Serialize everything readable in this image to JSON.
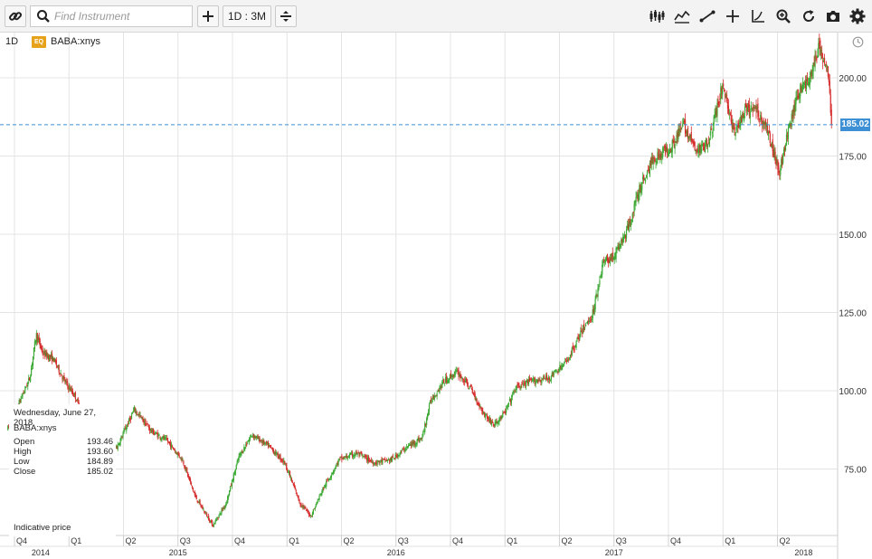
{
  "toolbar": {
    "link_icon": "link-icon",
    "search": {
      "placeholder": "Find Instrument",
      "value": ""
    },
    "add_icon": "plus-icon",
    "interval_label": "1D : 3M",
    "compare_icon": "compare-icon",
    "right_tools": [
      "candlestick-icon",
      "indicators-icon",
      "draw-line-icon",
      "crosshair-icon",
      "chart-type-icon",
      "zoom-icon",
      "refresh-icon",
      "camera-icon",
      "gear-icon"
    ]
  },
  "header": {
    "interval": "1D",
    "badge": "EQ",
    "symbol": "BABA:xnys"
  },
  "last_price": "185.02",
  "colors": {
    "up": "#3aa832",
    "down": "#d62b2b",
    "last_line": "#3d8fd6",
    "grid": "#e4e4e4"
  },
  "info_panel": {
    "date": "Wednesday, June 27, 2018",
    "symbol": "BABA:xnys",
    "rows": [
      {
        "label": "Open",
        "value": "193.46"
      },
      {
        "label": "High",
        "value": "193.60"
      },
      {
        "label": "Low",
        "value": "184.89"
      },
      {
        "label": "Close",
        "value": "185.02"
      }
    ],
    "note": "Indicative price"
  },
  "chart_data": {
    "type": "candlestick",
    "ylim": [
      53,
      215
    ],
    "y_ticks": [
      "200.00",
      "175.00",
      "150.00",
      "125.00",
      "100.00",
      "75.00"
    ],
    "y_tick_values": [
      200,
      175,
      150,
      125,
      100,
      75
    ],
    "x_range": [
      2014.8,
      2018.52
    ],
    "quarter_ticks": [
      {
        "label": "Q4",
        "x": 2014.75
      },
      {
        "label": "Q1",
        "x": 2015.0
      },
      {
        "label": "Q2",
        "x": 2015.25
      },
      {
        "label": "Q3",
        "x": 2015.5
      },
      {
        "label": "Q4",
        "x": 2015.75
      },
      {
        "label": "Q1",
        "x": 2016.0
      },
      {
        "label": "Q2",
        "x": 2016.25
      },
      {
        "label": "Q3",
        "x": 2016.5
      },
      {
        "label": "Q4",
        "x": 2016.75
      },
      {
        "label": "Q1",
        "x": 2017.0
      },
      {
        "label": "Q2",
        "x": 2017.25
      },
      {
        "label": "Q3",
        "x": 2017.5
      },
      {
        "label": "Q4",
        "x": 2017.75
      },
      {
        "label": "Q1",
        "x": 2018.0
      },
      {
        "label": "Q2",
        "x": 2018.25
      }
    ],
    "year_ticks": [
      {
        "label": "2014",
        "x": 2014.87
      },
      {
        "label": "2015",
        "x": 2015.5
      },
      {
        "label": "2016",
        "x": 2016.5
      },
      {
        "label": "2017",
        "x": 2017.5
      },
      {
        "label": "2018",
        "x": 2018.37
      }
    ],
    "price_path": [
      [
        2014.72,
        88
      ],
      [
        2014.82,
        104
      ],
      [
        2014.85,
        118
      ],
      [
        2014.88,
        112
      ],
      [
        2014.93,
        110
      ],
      [
        2014.98,
        103
      ],
      [
        2015.03,
        98
      ],
      [
        2015.08,
        88
      ],
      [
        2015.15,
        84
      ],
      [
        2015.22,
        82
      ],
      [
        2015.3,
        94
      ],
      [
        2015.38,
        87
      ],
      [
        2015.45,
        84
      ],
      [
        2015.52,
        78
      ],
      [
        2015.58,
        66
      ],
      [
        2015.66,
        57
      ],
      [
        2015.72,
        64
      ],
      [
        2015.78,
        79
      ],
      [
        2015.84,
        86
      ],
      [
        2015.92,
        82
      ],
      [
        2015.99,
        77
      ],
      [
        2016.06,
        64
      ],
      [
        2016.11,
        60
      ],
      [
        2016.16,
        68
      ],
      [
        2016.24,
        78
      ],
      [
        2016.32,
        80
      ],
      [
        2016.4,
        77
      ],
      [
        2016.48,
        78
      ],
      [
        2016.55,
        82
      ],
      [
        2016.62,
        85
      ],
      [
        2016.66,
        97
      ],
      [
        2016.72,
        103
      ],
      [
        2016.78,
        106
      ],
      [
        2016.84,
        101
      ],
      [
        2016.9,
        93
      ],
      [
        2016.95,
        89
      ],
      [
        2017.0,
        93
      ],
      [
        2017.05,
        101
      ],
      [
        2017.12,
        103
      ],
      [
        2017.2,
        104
      ],
      [
        2017.28,
        109
      ],
      [
        2017.36,
        120
      ],
      [
        2017.4,
        124
      ],
      [
        2017.45,
        141
      ],
      [
        2017.5,
        143
      ],
      [
        2017.56,
        151
      ],
      [
        2017.62,
        165
      ],
      [
        2017.68,
        174
      ],
      [
        2017.76,
        178
      ],
      [
        2017.82,
        185
      ],
      [
        2017.88,
        176
      ],
      [
        2017.94,
        181
      ],
      [
        2018.0,
        198
      ],
      [
        2018.05,
        182
      ],
      [
        2018.1,
        189
      ],
      [
        2018.15,
        190
      ],
      [
        2018.2,
        184
      ],
      [
        2018.26,
        170
      ],
      [
        2018.3,
        183
      ],
      [
        2018.35,
        196
      ],
      [
        2018.4,
        200
      ],
      [
        2018.44,
        210
      ],
      [
        2018.48,
        202
      ],
      [
        2018.5,
        185
      ]
    ]
  }
}
